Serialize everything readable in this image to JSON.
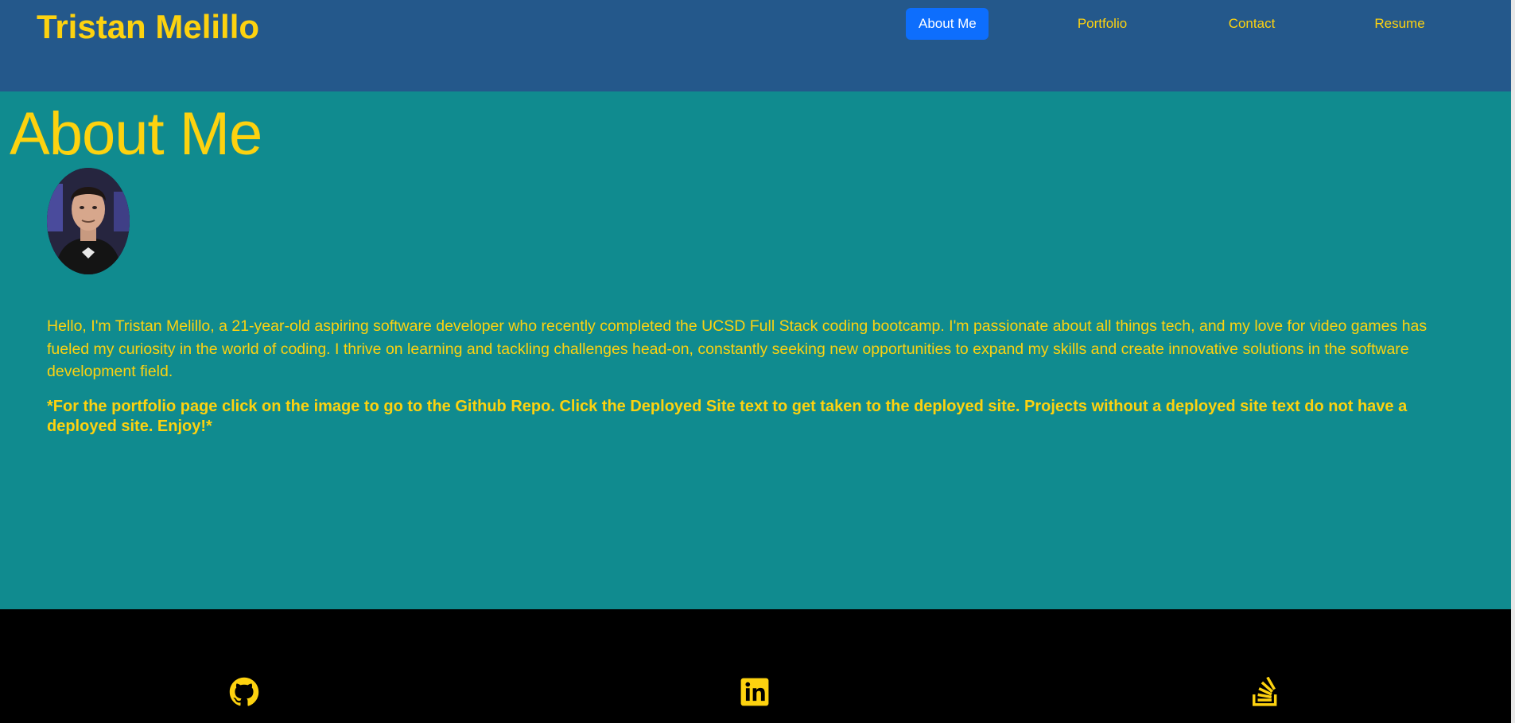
{
  "header": {
    "brand": "Tristan Melillo",
    "nav": [
      {
        "label": "About Me",
        "active": true
      },
      {
        "label": "Portfolio",
        "active": false
      },
      {
        "label": "Contact",
        "active": false
      },
      {
        "label": "Resume",
        "active": false
      }
    ]
  },
  "main": {
    "title": "About Me",
    "bio": "Hello, I'm Tristan Melillo, a 21-year-old aspiring software developer who recently completed the UCSD Full Stack coding bootcamp. I'm passionate about all things tech, and my love for video games has fueled my curiosity in the world of coding. I thrive on learning and tackling challenges head-on, constantly seeking new opportunities to expand my skills and create innovative solutions in the software development field.",
    "note": "*For the portfolio page click on the image to go to the Github Repo. Click the Deployed Site text to get taken to the deployed site. Projects without a deployed site text do not have a deployed site. Enjoy!*"
  },
  "footer": {
    "icons": [
      "github-icon",
      "linkedin-icon",
      "stackoverflow-icon"
    ]
  },
  "colors": {
    "header_bg": "#24588b",
    "main_bg": "#108b8f",
    "footer_bg": "#000000",
    "accent_yellow": "#fdd20f",
    "active_nav_bg": "#0d6efd"
  }
}
